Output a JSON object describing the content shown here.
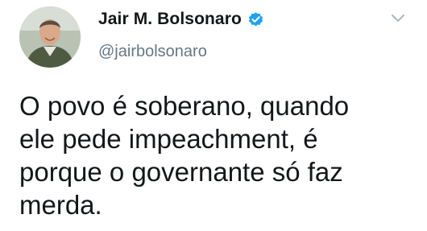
{
  "tweet": {
    "author": {
      "display_name": "Jair M. Bolsonaro",
      "handle": "@jairbolsonaro",
      "verified": true,
      "avatar_icon": "profile-photo"
    },
    "text": "O povo é soberano, quando\nele pede impeachment, é\nporque o governante só faz\nmerda.",
    "menu_icon": "chevron-down-icon"
  },
  "colors": {
    "name": "#14171a",
    "handle": "#657786",
    "verified_badge": "#1da1f2",
    "caret": "#aab8c2",
    "text": "#14171a"
  }
}
